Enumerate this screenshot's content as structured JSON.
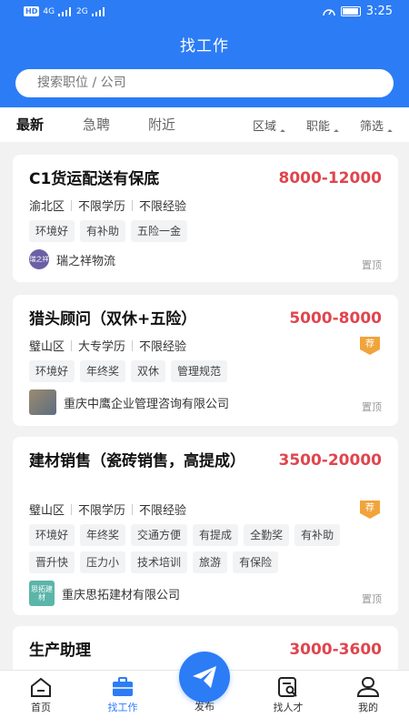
{
  "status_bar": {
    "time": "3:25",
    "network": [
      "4G",
      "2G"
    ]
  },
  "header": {
    "title": "找工作",
    "search_placeholder": "搜索职位 / 公司"
  },
  "filters": {
    "tabs": [
      "最新",
      "急聘",
      "附近"
    ],
    "dropdowns": [
      "区域",
      "职能",
      "筛选"
    ]
  },
  "jobs": [
    {
      "title": "C1货运配送有保底",
      "salary": "8000-12000",
      "meta": [
        "渝北区",
        "不限学历",
        "不限经验"
      ],
      "tags": [
        "环境好",
        "有补助",
        "五险一金"
      ],
      "company": "瑞之祥物流",
      "logo_text": "瑞之祥",
      "pinned": "置顶"
    },
    {
      "title": "猎头顾问（双休+五险）",
      "salary": "5000-8000",
      "meta": [
        "璧山区",
        "大专学历",
        "不限经验"
      ],
      "tags": [
        "环境好",
        "年终奖",
        "双休",
        "管理规范"
      ],
      "company": "重庆中鹰企业管理咨询有限公司",
      "badge": "荐",
      "pinned": "置顶"
    },
    {
      "title": "建材销售（瓷砖销售，高提成）",
      "salary": "3500-20000",
      "meta": [
        "璧山区",
        "不限学历",
        "不限经验"
      ],
      "tags": [
        "环境好",
        "年终奖",
        "交通方便",
        "有提成",
        "全勤奖",
        "有补助",
        "晋升快",
        "压力小",
        "技术培训",
        "旅游",
        "有保险"
      ],
      "company": "重庆思拓建材有限公司",
      "logo_text": "思拓建材",
      "badge": "荐",
      "pinned": "置顶"
    },
    {
      "title": "生产助理",
      "salary": "3000-3600"
    }
  ],
  "bottom_nav": {
    "home": "首页",
    "find_job": "找工作",
    "post": "发布",
    "find_talent": "找人才",
    "mine": "我的"
  },
  "colors": {
    "primary": "#2c7cf6",
    "salary": "#e0454e",
    "badge": "#f1a43b"
  }
}
